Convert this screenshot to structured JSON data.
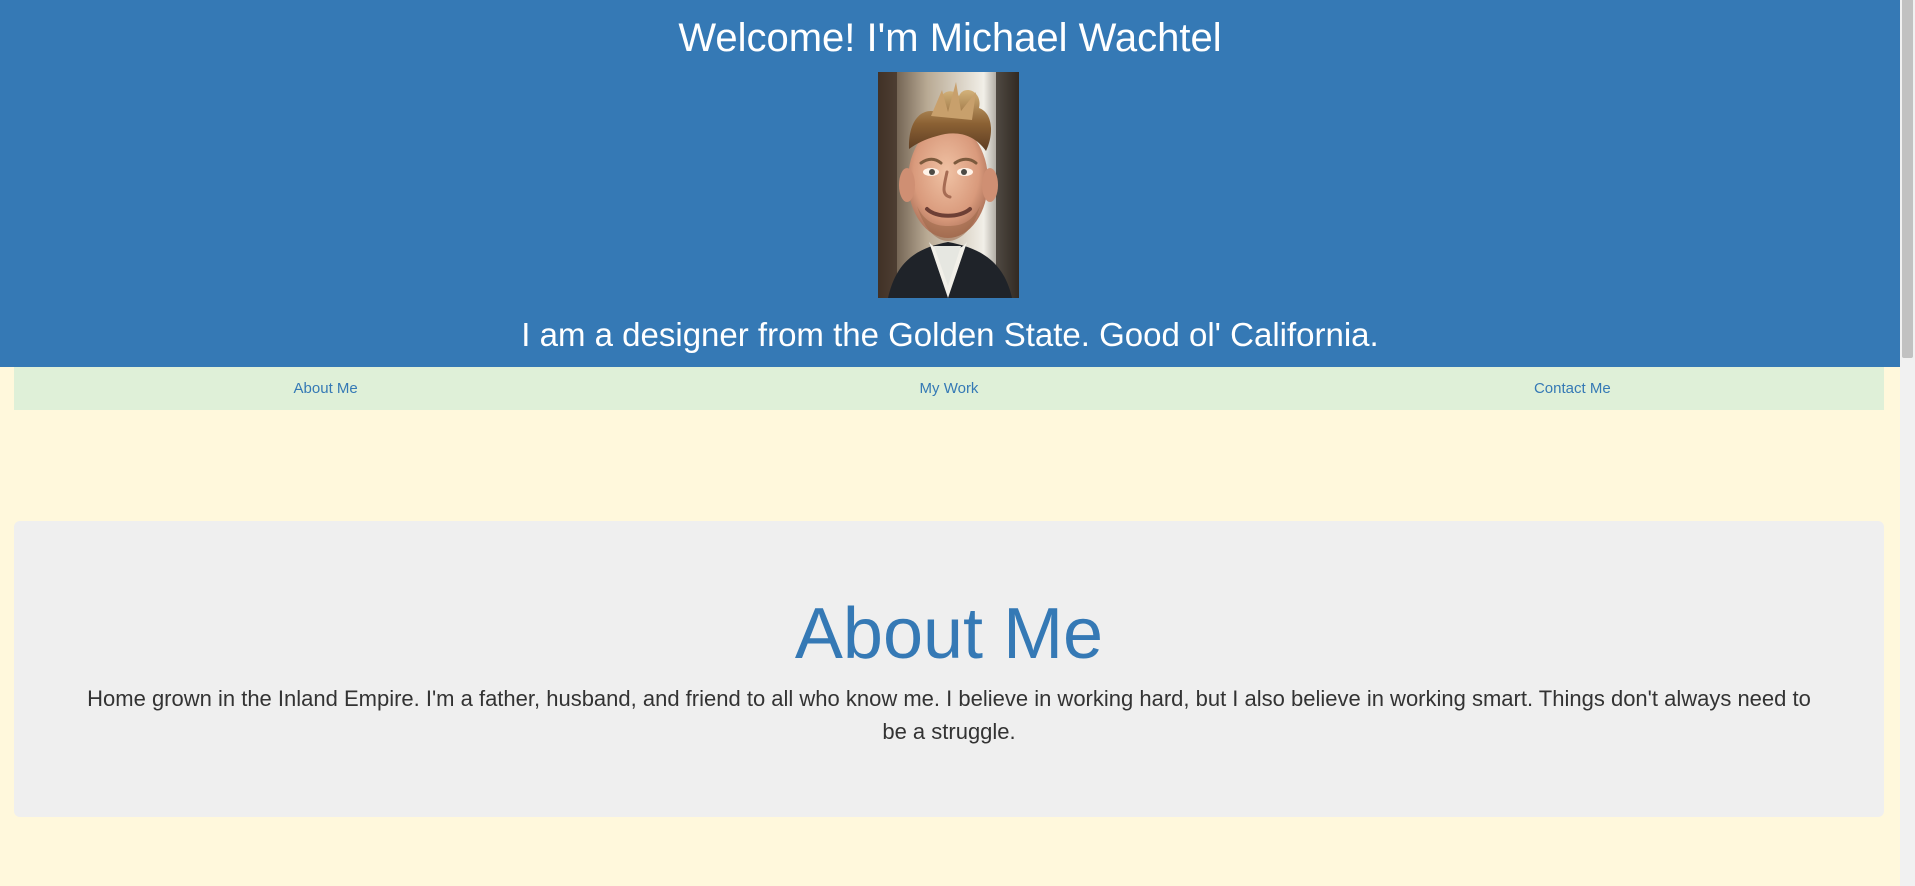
{
  "header": {
    "title": "Welcome! I'm Michael Wachtel",
    "tagline": "I am a designer from the Golden State. Good ol' California.",
    "photo_icon": "profile-photo"
  },
  "nav": {
    "items": [
      {
        "label": "About Me"
      },
      {
        "label": "My Work"
      },
      {
        "label": "Contact Me"
      }
    ]
  },
  "about": {
    "title": "About Me",
    "text": "Home grown in the Inland Empire. I'm a father, husband, and friend to all who know me. I believe in working hard, but I also believe in working smart. Things don't always need to be a struggle."
  },
  "colors": {
    "header_background": "#3579b5",
    "nav_background": "#dff0d8",
    "page_background": "#fff8dc",
    "card_background": "#efefef",
    "accent_text": "#3579b5"
  }
}
